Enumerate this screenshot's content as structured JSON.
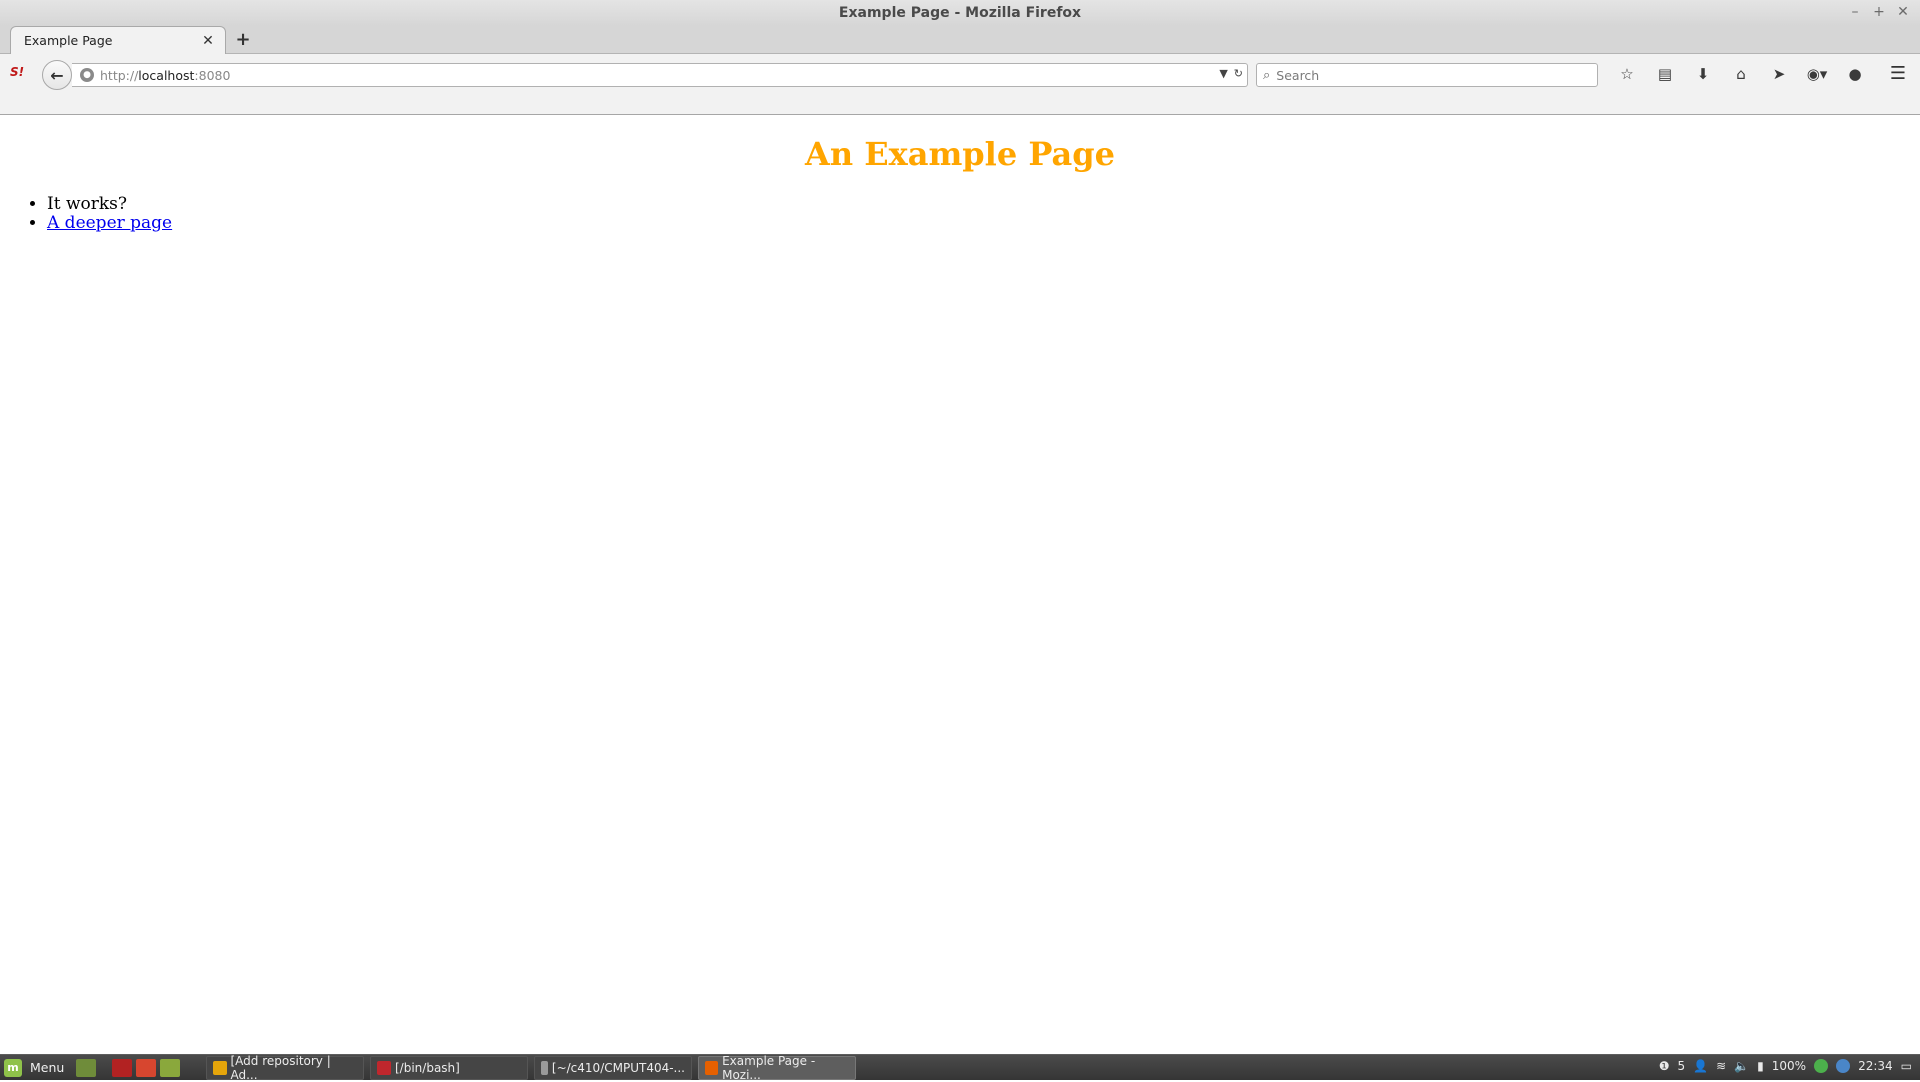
{
  "window": {
    "title": "Example Page - Mozilla Firefox",
    "controls": [
      "–",
      "+",
      "✕"
    ]
  },
  "tabs": [
    {
      "label": "Example Page",
      "close": "✕"
    }
  ],
  "newtab": "+",
  "navbar": {
    "back": "←",
    "url_scheme": "http://",
    "url_host": "localhost",
    "url_port": ":8080",
    "search_placeholder": "Search"
  },
  "toolbar_icons": [
    "star-icon",
    "reading-list-icon",
    "download-icon",
    "home-icon",
    "send-icon",
    "adblock-icon",
    "chat-icon"
  ],
  "page": {
    "heading": "An Example Page",
    "heading_color": "#ffa500",
    "items": [
      {
        "text": "It works?",
        "link": false
      },
      {
        "text": "A deeper page",
        "link": true
      }
    ]
  },
  "taskbar": {
    "menu_label": "Menu",
    "tasks": [
      {
        "label": "[Add repository | Ad...",
        "icon_color": "#e5a50a"
      },
      {
        "label": "[/bin/bash]",
        "icon_color": "#c0272d"
      },
      {
        "label": "[~/c410/CMPUT404-...",
        "icon_color": "#9a9a9a"
      },
      {
        "label": "Example Page - Mozi...",
        "icon_color": "#e66000",
        "active": true
      }
    ],
    "tray": {
      "notifications": "5",
      "battery": "100%",
      "clock": "22:34"
    }
  }
}
